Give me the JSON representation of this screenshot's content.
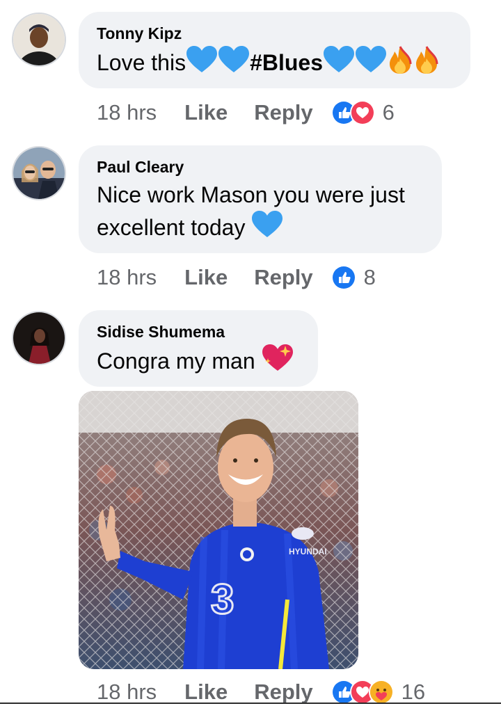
{
  "comments": [
    {
      "author": "Tonny Kipz",
      "text_parts": [
        "Love this",
        "#Blues"
      ],
      "time": "18 hrs",
      "like_label": "Like",
      "reply_label": "Reply",
      "reaction_types": [
        "like",
        "love"
      ],
      "reaction_count": "6"
    },
    {
      "author": "Paul Cleary",
      "text_line1": "Nice work Mason you were just",
      "text_line2": "excellent today",
      "time": "18 hrs",
      "like_label": "Like",
      "reply_label": "Reply",
      "reaction_types": [
        "like"
      ],
      "reaction_count": "8"
    },
    {
      "author": "Sidise Shumema",
      "text": "Congra my man",
      "attachment_icon": "photo-attachment",
      "time": "18 hrs",
      "like_label": "Like",
      "reply_label": "Reply",
      "reaction_types": [
        "like",
        "love",
        "care"
      ],
      "reaction_count": "16"
    }
  ],
  "colors": {
    "bubble": "#f0f2f5",
    "meta_text": "#65676b",
    "like_blue": "#1877f2",
    "love_red": "#f33e58",
    "blue_heart": "#3aa0f0"
  },
  "photo": {
    "jersey_sponsor": "HYUNDAI",
    "jersey_number": "3"
  }
}
